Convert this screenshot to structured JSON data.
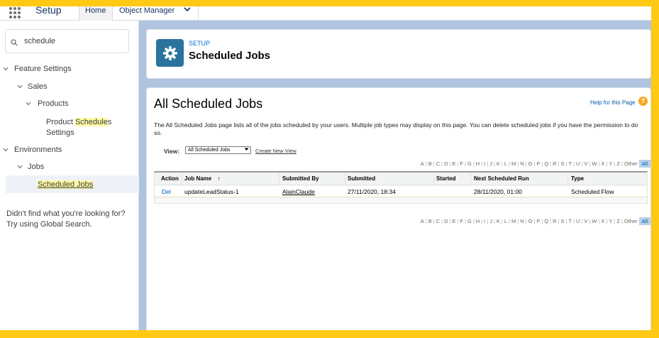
{
  "topbar": {
    "app_title": "Setup",
    "tabs": [
      {
        "label": "Home"
      },
      {
        "label": "Object Manager"
      }
    ]
  },
  "sidebar": {
    "search_value": "schedule",
    "tree": {
      "feature_settings": "Feature Settings",
      "sales": "Sales",
      "products": "Products",
      "product_schedules_pre": "Product ",
      "product_schedules_hl": "Schedule",
      "product_schedules_post": "s",
      "product_schedules_line2": "Settings",
      "environments": "Environments",
      "jobs": "Jobs",
      "scheduled_jobs": "Scheduled Jobs"
    },
    "help_line1": "Didn't find what you're looking for?",
    "help_line2": "Try using Global Search."
  },
  "header": {
    "eyebrow": "SETUP",
    "title": "Scheduled Jobs"
  },
  "main": {
    "title": "All Scheduled Jobs",
    "help_link": "Help for this Page",
    "description": "The All Scheduled Jobs page lists all of the jobs scheduled by your users. Multiple job types may display on this page. You can delete scheduled jobs if you have the permission to do so.",
    "view_label": "View:",
    "view_selected": "All Scheduled Jobs",
    "create_view": "Create New View",
    "alphabet": [
      "A",
      "B",
      "C",
      "D",
      "E",
      "F",
      "G",
      "H",
      "I",
      "J",
      "K",
      "L",
      "M",
      "N",
      "O",
      "P",
      "Q",
      "R",
      "S",
      "T",
      "U",
      "V",
      "W",
      "X",
      "Y",
      "Z",
      "Other",
      "All"
    ],
    "table": {
      "headers": [
        "Action",
        "Job Name",
        "Submitted By",
        "Submitted",
        "Started",
        "Next Scheduled Run",
        "Type"
      ],
      "sort_indicator": "↑",
      "rows": [
        {
          "action": "Del",
          "job_name": "updateLeadStatus-1",
          "submitted_by": "AlainClaude",
          "submitted": "27/11/2020, 18:34",
          "started": "",
          "next_run": "28/11/2020, 01:00",
          "type": "Scheduled Flow"
        }
      ]
    }
  },
  "colors": {
    "accent": "#0070d2",
    "frame": "#ffc914",
    "header_icon": "#2a739e",
    "highlight": "#fdf9a4"
  }
}
